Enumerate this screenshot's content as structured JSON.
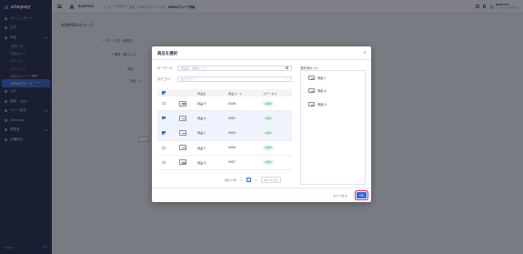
{
  "sidebar": {
    "brand": "elepay",
    "items": [
      {
        "label": "ダッシュボード"
      },
      {
        "label": "注文"
      },
      {
        "label": "商品"
      }
    ],
    "sub_items": [
      {
        "label": "商品一覧"
      },
      {
        "label": "商品セット"
      },
      {
        "label": "カテゴリー"
      },
      {
        "label": "オプション"
      },
      {
        "label": "商品グループ",
        "badge": "NEW"
      },
      {
        "label": "MENUグループ",
        "badge": "NEW"
      }
    ],
    "items_after": [
      {
        "label": "元付"
      },
      {
        "label": "顧客",
        "badge": "NEW"
      },
      {
        "label": "ページ設定"
      },
      {
        "label": "Webhook"
      },
      {
        "label": "開発者"
      },
      {
        "label": "店舗設定"
      }
    ],
    "footer": {
      "label": "ELEPAY"
    }
  },
  "topbar": {
    "brand": "ELEFYLE",
    "breadcrumb": [
      "ホーム",
      "/",
      "OneQR",
      "/",
      "商品",
      "/",
      "MENUグループ一覧",
      "/"
    ],
    "breadcrumb_current": "MENUグループ詳細",
    "user_name": "ELEFYLE",
    "user_sub": "エレファイル株式会社"
  },
  "page": {
    "title": "新規MENUグループ",
    "labels": [
      "* グループ名（新規名）",
      "* 期間（期日入力）",
      "商品",
      "商品・1"
    ]
  },
  "modal": {
    "title": "商品を選択",
    "keyword_label": "キーワード：",
    "keyword_placeholder": "商品名、商品コード",
    "category_label": "カテゴリ：",
    "category_placeholder": "全カテゴリー",
    "columns": [
      "商品名",
      "商品コード",
      "ステータス"
    ],
    "rows": [
      {
        "name": "商品 H",
        "code": "0008",
        "status": "公開中",
        "checked": false
      },
      {
        "name": "商品 A",
        "code": "0001",
        "status": "公開中",
        "checked": true
      },
      {
        "name": "商品 C",
        "code": "0003",
        "status": "公開中",
        "checked": true
      },
      {
        "name": "商品 F",
        "code": "0006",
        "status": "公開中",
        "checked": false
      },
      {
        "name": "商品 G",
        "code": "0007",
        "status": "公開中",
        "checked": false
      }
    ],
    "pager": {
      "total": "合計 5 件",
      "prev": "<",
      "current": "1",
      "next": ">",
      "size": "10 / ページ"
    },
    "selected_label": "選択済み (3)",
    "selected_items": [
      {
        "name": "商品 C"
      },
      {
        "name": "商品 A"
      },
      {
        "name": "商品 H"
      }
    ],
    "cancel_label": "キャンセル",
    "ok_label": "OK",
    "close_icon": "×"
  },
  "colors": {
    "accent": "#2f67d8",
    "sidebar": "#1f2740",
    "highlight_ring": "#e0245e"
  }
}
